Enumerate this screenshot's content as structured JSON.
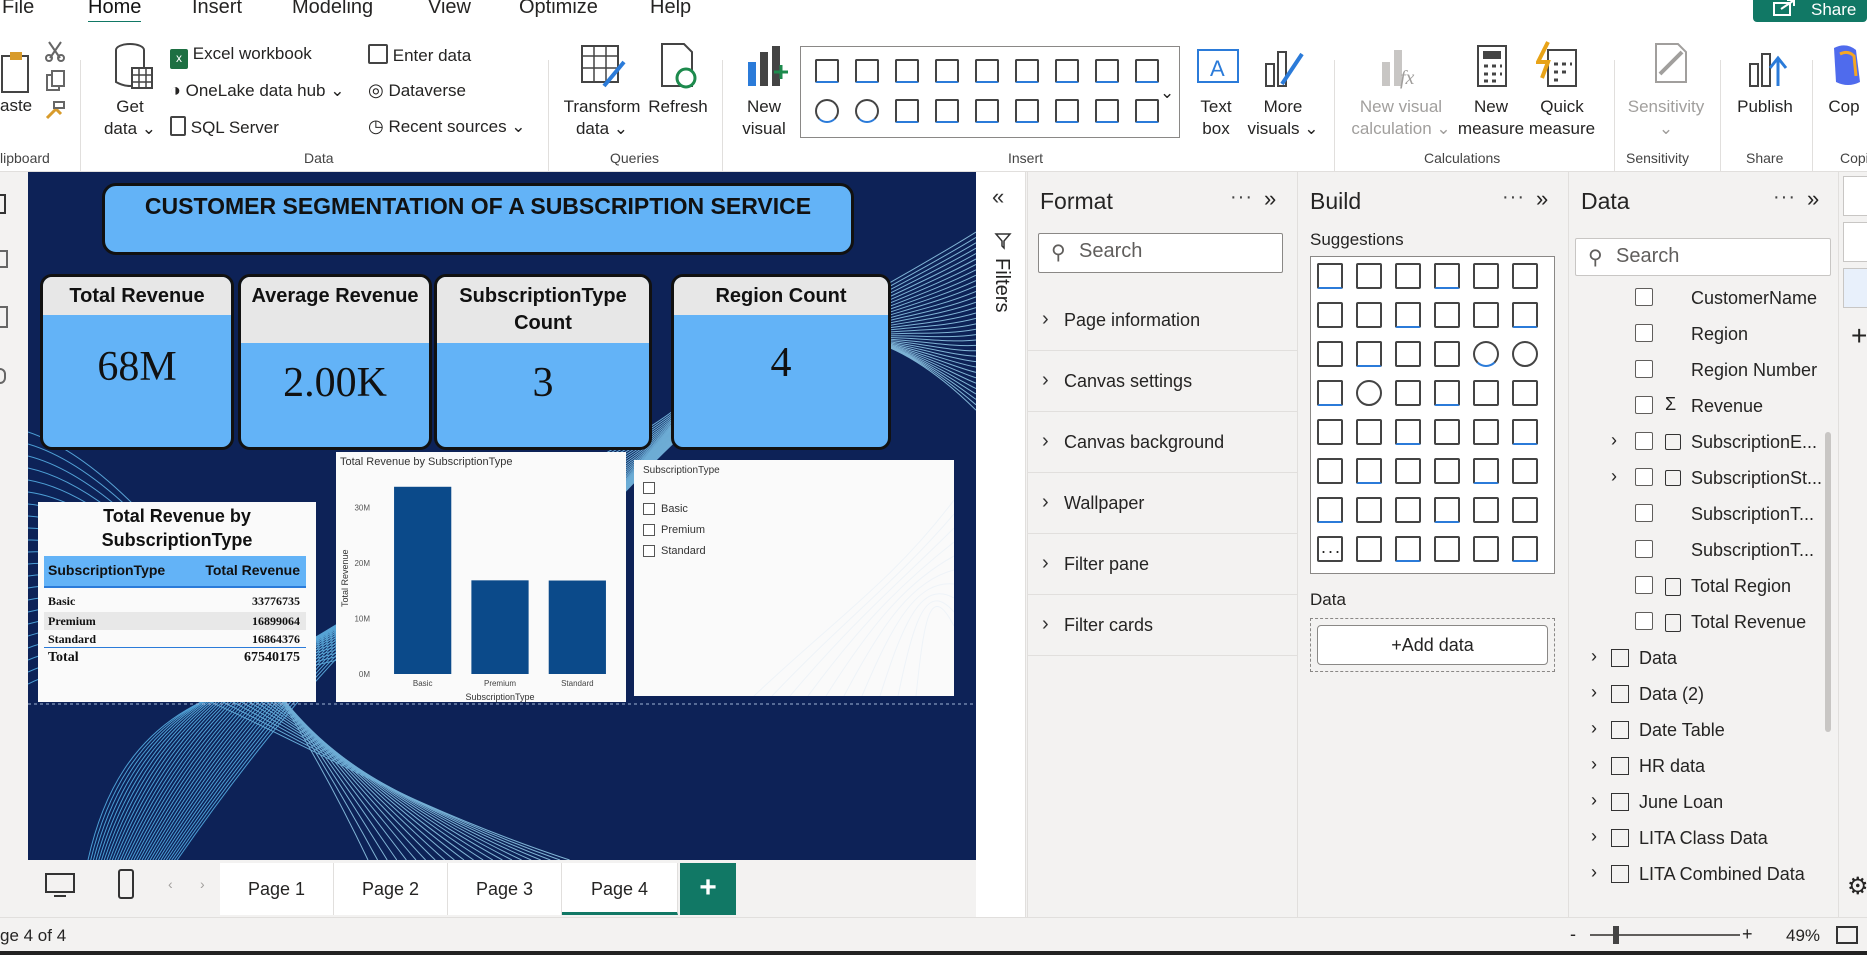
{
  "menu": {
    "tabs": [
      "File",
      "Home",
      "Insert",
      "Modeling",
      "View",
      "Optimize",
      "Help"
    ],
    "share": "Share"
  },
  "ribbon": {
    "clipboard": {
      "paste": "aste",
      "group": "lipboard"
    },
    "data": {
      "get_data_1": "Get",
      "get_data_2": "data",
      "excel": "Excel workbook",
      "onelake": "OneLake data hub",
      "sql": "SQL Server",
      "enter": "Enter data",
      "dataverse": "Dataverse",
      "recent": "Recent sources",
      "group": "Data"
    },
    "queries": {
      "transform_1": "Transform",
      "transform_2": "data",
      "refresh": "Refresh",
      "group": "Queries"
    },
    "insert": {
      "new_visual_1": "New",
      "new_visual_2": "visual",
      "text_box_1": "Text",
      "text_box_2": "box",
      "more_1": "More",
      "more_2": "visuals",
      "group": "Insert"
    },
    "calculations": {
      "nvc_1": "New visual",
      "nvc_2": "calculation",
      "nm_1": "New",
      "nm_2": "measure",
      "qm_1": "Quick",
      "qm_2": "measure",
      "group": "Calculations"
    },
    "sensitivity": {
      "label": "Sensitivity",
      "group": "Sensitivity"
    },
    "share": {
      "publish": "Publish",
      "group": "Share"
    },
    "copilot": {
      "label": "Cop",
      "group": "Copi"
    }
  },
  "report": {
    "title": "CUSTOMER SEGMENTATION OF A SUBSCRIPTION SERVICE",
    "cards": [
      {
        "label": "Total Revenue",
        "value": "68M"
      },
      {
        "label": "Average Revenue",
        "value": "2.00K"
      },
      {
        "label": "SubscriptionType Count",
        "value": "3"
      },
      {
        "label": "Region Count",
        "value": "4"
      }
    ],
    "table": {
      "title": "Total Revenue by SubscriptionType",
      "headers": [
        "SubscriptionType",
        "Total Revenue"
      ],
      "rows": [
        [
          "Basic",
          "33776735"
        ],
        [
          "Premium",
          "16899064"
        ],
        [
          "Standard",
          "16864376"
        ]
      ],
      "total": [
        "Total",
        "67540175"
      ]
    },
    "slicer": {
      "title": "SubscriptionType",
      "items": [
        "",
        "Basic",
        "Premium",
        "Standard"
      ]
    }
  },
  "chart_data": {
    "type": "bar",
    "title": "Total Revenue by SubscriptionType",
    "xlabel": "SubscriptionType",
    "ylabel": "Total Revenue",
    "categories": [
      "Basic",
      "Premium",
      "Standard"
    ],
    "values": [
      33776735,
      16899064,
      16864376
    ],
    "ylim": [
      0,
      35000000
    ],
    "yticks": [
      0,
      10000000,
      20000000,
      30000000
    ],
    "ytick_labels": [
      "0M",
      "10M",
      "20M",
      "30M"
    ],
    "color": "#0b4a8a"
  },
  "filters_label": "Filters",
  "format_pane": {
    "title": "Format",
    "search": "Search",
    "items": [
      "Page information",
      "Canvas settings",
      "Canvas background",
      "Wallpaper",
      "Filter pane",
      "Filter cards"
    ]
  },
  "build_pane": {
    "title": "Build",
    "suggestions": "Suggestions",
    "data_label": "Data",
    "add_data": "+Add data",
    "more": "..."
  },
  "data_pane": {
    "title": "Data",
    "search": "Search",
    "fields": [
      "CustomerName",
      "Region",
      "Region Number",
      "Revenue",
      "SubscriptionE...",
      "SubscriptionSt...",
      "SubscriptionT...",
      "SubscriptionT...",
      "Total Region",
      "Total Revenue"
    ],
    "tables": [
      "Data",
      "Data (2)",
      "Date Table",
      "HR data",
      "June Loan",
      "LITA Class Data",
      "LITA Combined Data"
    ]
  },
  "pages": [
    "Page 1",
    "Page 2",
    "Page 3",
    "Page 4"
  ],
  "status": {
    "page": "ge 4 of 4",
    "zoom": "49%",
    "zoom_minus": "-",
    "zoom_plus": "+"
  }
}
